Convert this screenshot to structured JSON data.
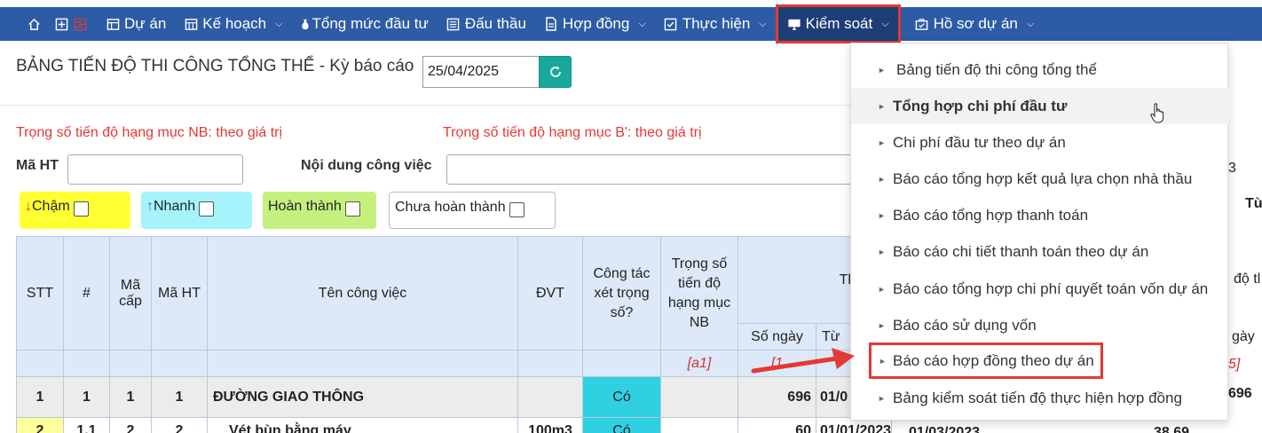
{
  "nav": {
    "items": [
      {
        "label": "Dự án",
        "icon": "table-icon",
        "caret": false
      },
      {
        "label": "Kế hoạch",
        "icon": "calendar-table-icon",
        "caret": true
      },
      {
        "label": "Tổng mức đầu tư",
        "icon": "money-bag-icon",
        "caret": false
      },
      {
        "label": "Đấu thầu",
        "icon": "list-icon",
        "caret": false
      },
      {
        "label": "Hợp đồng",
        "icon": "document-icon",
        "caret": true
      },
      {
        "label": "Thực hiện",
        "icon": "check-square-icon",
        "caret": true
      },
      {
        "label": "Kiểm soát",
        "icon": "monitor-icon",
        "caret": true
      },
      {
        "label": "Hồ sơ dự án",
        "icon": "briefcase-check-icon",
        "caret": true
      }
    ]
  },
  "page": {
    "title": "BẢNG TIẾN ĐỘ THI CÔNG TỔNG THỂ - Kỳ báo cáo",
    "report_date": "25/04/2025"
  },
  "notes": {
    "weight_nb": "Trọng số tiến độ hạng mục NB: theo giá trị",
    "weight_b": "Trọng số tiến độ hạng mục B': theo giá trị"
  },
  "filters": {
    "ma_ht_label": "Mã HT",
    "ma_ht_value": "",
    "noi_dung_label": "Nội dung công việc",
    "noi_dung_value": "",
    "cham": "Chậm",
    "nhanh": "Nhanh",
    "hoan_thanh": "Hoàn thành",
    "chua_hoan_thanh": "Chưa hoàn thành",
    "colors": {
      "cham": "#ffff33",
      "nhanh": "#a6f3fb",
      "hoan_thanh": "#c6f07e"
    }
  },
  "table": {
    "headers": {
      "stt": "STT",
      "hash": "#",
      "ma_cap": "Mã cấp",
      "ma_ht": "Mã HT",
      "ten_cong_viec": "Tên công việc",
      "dvt": "ĐVT",
      "cong_tac": "Công tác xét trọng số?",
      "trong_so": "Trọng số tiến độ hạng mục NB",
      "thoi_gian": "Thời gia",
      "so_ngay": "Số ngày",
      "tu": "Từ"
    },
    "markers": {
      "a1": "[a1]",
      "one": "[1"
    },
    "rows": [
      {
        "stt": "1",
        "hash": "1",
        "ma_cap": "1",
        "ma_ht": "1",
        "ten": "ĐƯỜNG GIAO THÔNG",
        "dvt": "",
        "cong_tac": "Có",
        "trong_so": "",
        "so_ngay": "696",
        "tu": "01/0"
      },
      {
        "stt": "2",
        "hash": "1.1",
        "ma_cap": "2",
        "ma_ht": "2",
        "ten": "Vét bùn bằng máy",
        "dvt": "100m3",
        "cong_tac": "Có",
        "trong_so": "",
        "so_ngay": "60",
        "tu": "01/01/2023",
        "den": "01/03/2023",
        "value": "38,69"
      }
    ]
  },
  "right_fragments": {
    "b_frag": "3",
    "tu_frag": "Từ",
    "do_frag": "độ tl",
    "gay_frag": "gày",
    "bracket_frag": "5]",
    "num_frag": "696"
  },
  "dropdown": {
    "items": [
      "Bảng tiến độ thi công tổng thể",
      "Tổng hợp chi phí đầu tư",
      "Chi phí đầu tư theo dự án",
      "Báo cáo tổng hợp kết quả lựa chọn nhà thầu",
      "Báo cáo tổng hợp thanh toán",
      "Báo cáo chi tiết thanh toán theo dự án",
      "Báo cáo tổng hợp chi phí quyết toán vốn dự án",
      "Báo cáo sử dụng vốn",
      "Báo cáo hợp đồng theo dự án",
      "Bảng kiểm soát tiến độ thực hiện hợp đồng"
    ]
  }
}
